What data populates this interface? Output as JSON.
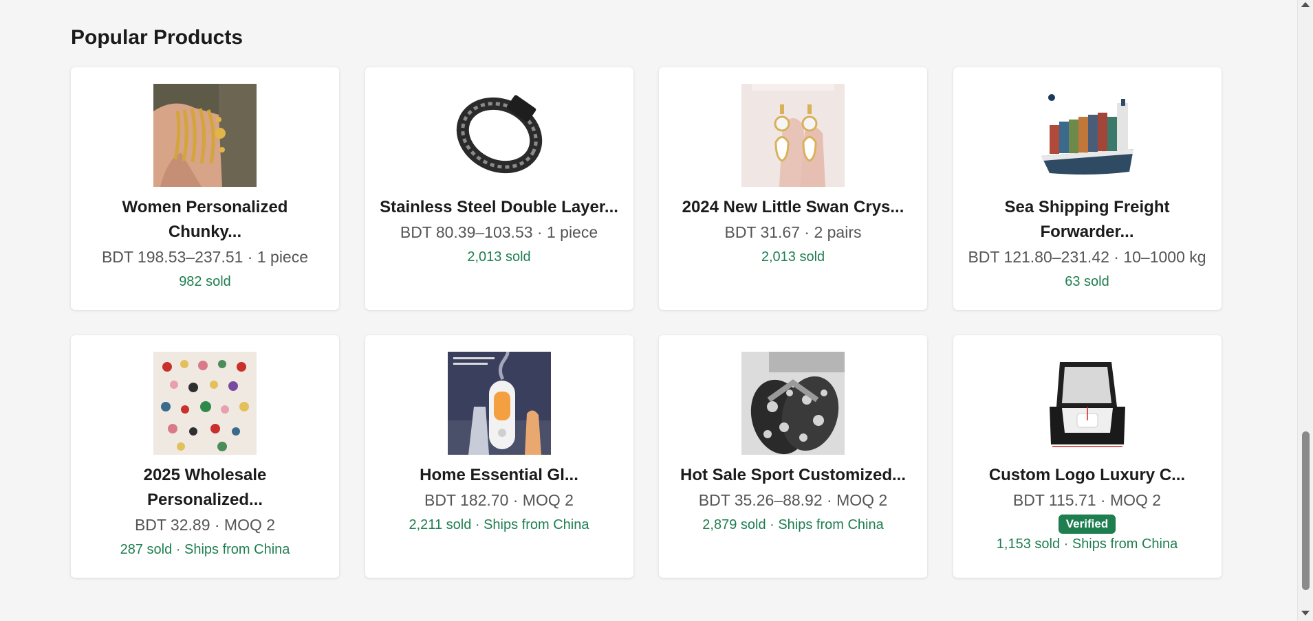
{
  "section": {
    "title": "Popular Products"
  },
  "products": [
    {
      "title_line1": "Women Personalized",
      "title_line2": "Chunky...",
      "price": "BDT 198.53–237.51 · 1 piece",
      "sold": "982 sold",
      "icon": "gold-bracelets-image"
    },
    {
      "title_line1": "Stainless Steel Double Layer...",
      "title_line2": "",
      "price": "BDT 80.39–103.53 · 1 piece",
      "sold": "2,013 sold",
      "icon": "chain-bracelet-image"
    },
    {
      "title_line1": "2024 New Little Swan Crys...",
      "title_line2": "",
      "price": "BDT 31.67 · 2 pairs",
      "sold": "2,013 sold",
      "icon": "swan-earrings-image"
    },
    {
      "title_line1": "Sea Shipping Freight",
      "title_line2": "Forwarder...",
      "price": "BDT 121.80–231.42 · 10–1000 kg",
      "sold": "63 sold",
      "icon": "cargo-ship-image"
    },
    {
      "title_line1": "2025 Wholesale",
      "title_line2": "Personalized...",
      "price": "BDT 32.89 · MOQ 2",
      "sold": "287 sold · Ships from China",
      "icon": "earrings-assortment-image"
    },
    {
      "title_line1": "Home Essential Gl...",
      "title_line2": "",
      "price": "BDT 182.70 · MOQ 2",
      "sold": "2,211 sold · Ships from China",
      "icon": "humidifier-image"
    },
    {
      "title_line1": "Hot Sale Sport Customized...",
      "title_line2": "",
      "price": "BDT 35.26–88.92 · MOQ 2",
      "sold": "2,879 sold · Ships from China",
      "icon": "sport-slippers-image"
    },
    {
      "title_line1": "Custom Logo Luxury C...",
      "title_line2": "",
      "price": "BDT 115.71 · MOQ 2",
      "badge": "Verified",
      "sold": "1,153 sold · Ships from China",
      "icon": "watch-box-image"
    }
  ],
  "colors": {
    "accent_green": "#1e7e4f",
    "background": "#f5f5f5"
  }
}
